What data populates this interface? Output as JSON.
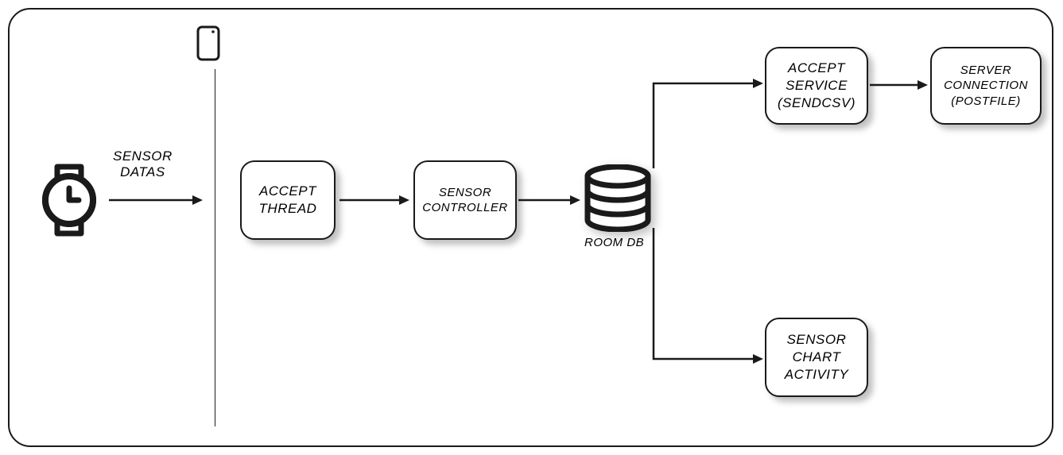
{
  "labels": {
    "sensor_datas": "SENSOR\nDATAS",
    "room_db": "ROOM DB"
  },
  "boxes": {
    "accept_thread": "ACCEPT\nTHREAD",
    "sensor_controller": "SENSOR\nCONTROLLER",
    "accept_service": "ACCEPT\nSERVICE\n(SENDCSV)",
    "server_connection": "SERVER\nCONNECTION\n(POSTFILE)",
    "sensor_chart_activity": "SENSOR\nCHART\nACTIVITY"
  },
  "icons": {
    "watch": "watch-icon",
    "phone": "phone-icon",
    "database": "database-icon"
  },
  "diagram": {
    "type": "flow",
    "nodes": [
      {
        "id": "watch",
        "type": "icon",
        "label": "watch"
      },
      {
        "id": "phone",
        "type": "icon",
        "label": "phone"
      },
      {
        "id": "accept_thread",
        "type": "box"
      },
      {
        "id": "sensor_controller",
        "type": "box"
      },
      {
        "id": "room_db",
        "type": "database"
      },
      {
        "id": "accept_service",
        "type": "box"
      },
      {
        "id": "server_connection",
        "type": "box"
      },
      {
        "id": "sensor_chart_activity",
        "type": "box"
      }
    ],
    "edges": [
      {
        "from": "watch",
        "to": "accept_thread",
        "label": "SENSOR DATAS"
      },
      {
        "from": "accept_thread",
        "to": "sensor_controller"
      },
      {
        "from": "sensor_controller",
        "to": "room_db"
      },
      {
        "from": "room_db",
        "to": "accept_service"
      },
      {
        "from": "accept_service",
        "to": "server_connection"
      },
      {
        "from": "room_db",
        "to": "sensor_chart_activity"
      }
    ]
  }
}
